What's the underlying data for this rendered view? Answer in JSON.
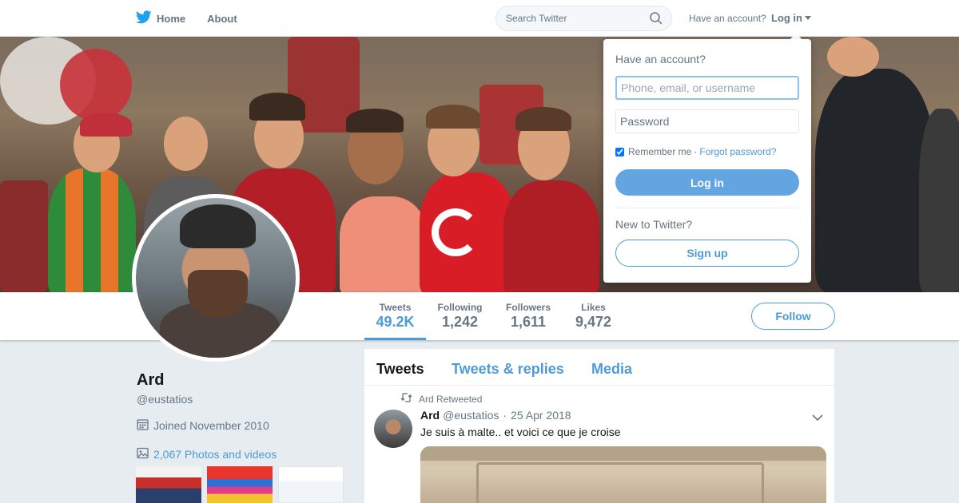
{
  "nav": {
    "home_label": "Home",
    "about_label": "About",
    "home_icon": "twitter-bird-icon"
  },
  "search": {
    "placeholder": "Search Twitter",
    "icon": "search-icon"
  },
  "account": {
    "prompt": "Have an account?",
    "login_label": "Log in"
  },
  "profile": {
    "name": "Ard",
    "handle": "@eustatios",
    "joined": "Joined November 2010",
    "photos_videos": "2,067 Photos and videos",
    "follow_label": "Follow"
  },
  "stats": [
    {
      "label": "Tweets",
      "value": "49.2K",
      "active": true
    },
    {
      "label": "Following",
      "value": "1,242",
      "active": false
    },
    {
      "label": "Followers",
      "value": "1,611",
      "active": false
    },
    {
      "label": "Likes",
      "value": "9,472",
      "active": false
    }
  ],
  "timeline": {
    "tabs": [
      "Tweets",
      "Tweets & replies",
      "Media"
    ],
    "active_tab": "Tweets",
    "tweets": [
      {
        "retweeted_by": "Ard Retweeted",
        "name": "Ard",
        "handle": "@eustatios",
        "separator": "·",
        "date": "25 Apr 2018",
        "text": "Je suis à malte.. et voici ce que je croise"
      }
    ]
  },
  "login_dropdown": {
    "title": "Have an account?",
    "username_placeholder": "Phone, email, or username",
    "password_placeholder": "Password",
    "remember_label": "Remember me",
    "separator": "·",
    "forgot_label": "Forgot password?",
    "remember_checked": true,
    "login_button": "Log in",
    "new_prompt": "New to Twitter?",
    "signup_button": "Sign up"
  },
  "colors": {
    "accent": "#4c9bd8",
    "login_button_bg": "#63a5e0",
    "text_primary": "#14171a",
    "text_secondary": "#657786",
    "page_bg": "#e6ecf0"
  }
}
